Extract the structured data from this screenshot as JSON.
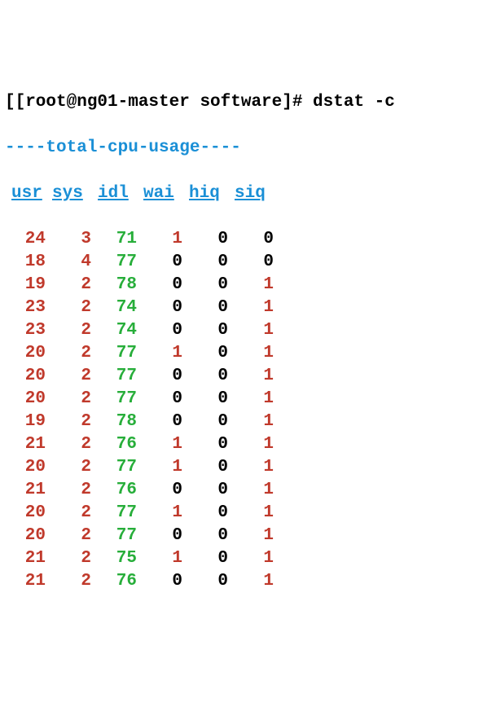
{
  "prompt": "[[root@ng01-master software]# dstat -c",
  "header_dash": "----total-cpu-usage----",
  "cols": [
    "usr",
    "sys",
    "idl",
    "wai",
    "hiq",
    "siq"
  ],
  "chart_data": {
    "type": "table",
    "title": "total-cpu-usage",
    "columns": [
      "usr",
      "sys",
      "idl",
      "wai",
      "hiq",
      "siq"
    ],
    "rows": [
      {
        "usr": 24,
        "sys": 3,
        "idl": 71,
        "wai": 1,
        "hiq": 0,
        "siq": 0
      },
      {
        "usr": 18,
        "sys": 4,
        "idl": 77,
        "wai": 0,
        "hiq": 0,
        "siq": 0
      },
      {
        "usr": 19,
        "sys": 2,
        "idl": 78,
        "wai": 0,
        "hiq": 0,
        "siq": 1
      },
      {
        "usr": 23,
        "sys": 2,
        "idl": 74,
        "wai": 0,
        "hiq": 0,
        "siq": 1
      },
      {
        "usr": 23,
        "sys": 2,
        "idl": 74,
        "wai": 0,
        "hiq": 0,
        "siq": 1
      },
      {
        "usr": 20,
        "sys": 2,
        "idl": 77,
        "wai": 1,
        "hiq": 0,
        "siq": 1
      },
      {
        "usr": 20,
        "sys": 2,
        "idl": 77,
        "wai": 0,
        "hiq": 0,
        "siq": 1
      },
      {
        "usr": 20,
        "sys": 2,
        "idl": 77,
        "wai": 0,
        "hiq": 0,
        "siq": 1
      },
      {
        "usr": 19,
        "sys": 2,
        "idl": 78,
        "wai": 0,
        "hiq": 0,
        "siq": 1
      },
      {
        "usr": 21,
        "sys": 2,
        "idl": 76,
        "wai": 1,
        "hiq": 0,
        "siq": 1
      },
      {
        "usr": 20,
        "sys": 2,
        "idl": 77,
        "wai": 1,
        "hiq": 0,
        "siq": 1
      },
      {
        "usr": 21,
        "sys": 2,
        "idl": 76,
        "wai": 0,
        "hiq": 0,
        "siq": 1
      },
      {
        "usr": 20,
        "sys": 2,
        "idl": 77,
        "wai": 1,
        "hiq": 0,
        "siq": 1
      },
      {
        "usr": 20,
        "sys": 2,
        "idl": 77,
        "wai": 0,
        "hiq": 0,
        "siq": 1
      },
      {
        "usr": 21,
        "sys": 2,
        "idl": 75,
        "wai": 1,
        "hiq": 0,
        "siq": 1
      },
      {
        "usr": 21,
        "sys": 2,
        "idl": 76,
        "wai": 0,
        "hiq": 0,
        "siq": 1
      }
    ]
  }
}
